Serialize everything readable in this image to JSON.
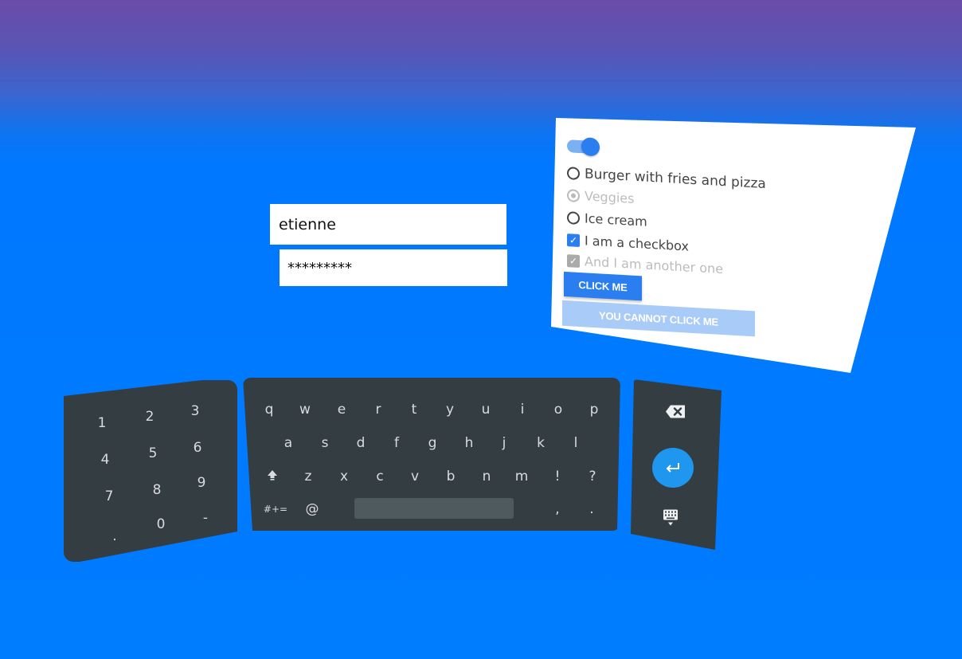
{
  "login": {
    "username_value": "etienne",
    "password_value": "*********"
  },
  "options": {
    "toggle_on": true,
    "radios": [
      {
        "label": "Burger with fries and pizza",
        "selected": false,
        "disabled": false
      },
      {
        "label": "Veggies",
        "selected": true,
        "disabled": true
      },
      {
        "label": "Ice cream",
        "selected": false,
        "disabled": false
      }
    ],
    "checkboxes": [
      {
        "label": "I am a checkbox",
        "checked": true,
        "disabled": false
      },
      {
        "label": "And I am another one",
        "checked": true,
        "disabled": true
      }
    ],
    "click_button": "CLICK ME",
    "disabled_button": "YOU CANNOT CLICK ME"
  },
  "numpad": {
    "keys": [
      "1",
      "2",
      "3",
      "4",
      "5",
      "6",
      "7",
      "8",
      "9",
      ".",
      "0",
      "-"
    ]
  },
  "keyboard": {
    "row1": [
      "q",
      "w",
      "e",
      "r",
      "t",
      "y",
      "u",
      "i",
      "o",
      "p"
    ],
    "row2": [
      "a",
      "s",
      "d",
      "f",
      "g",
      "h",
      "j",
      "k",
      "l"
    ],
    "row3": [
      "z",
      "x",
      "c",
      "v",
      "b",
      "n",
      "m",
      "!",
      "?"
    ],
    "symbols_key": "#+=",
    "at_key": "@",
    "comma_key": ",",
    "period_key": "."
  },
  "icons": {
    "shift": "shift-icon",
    "backspace": "backspace-icon",
    "enter": "enter-icon",
    "hide_keyboard": "keyboard-hide-icon"
  },
  "colors": {
    "accent": "#2a7ef0",
    "keyboard_bg": "#343d42",
    "background": "#007cff"
  }
}
